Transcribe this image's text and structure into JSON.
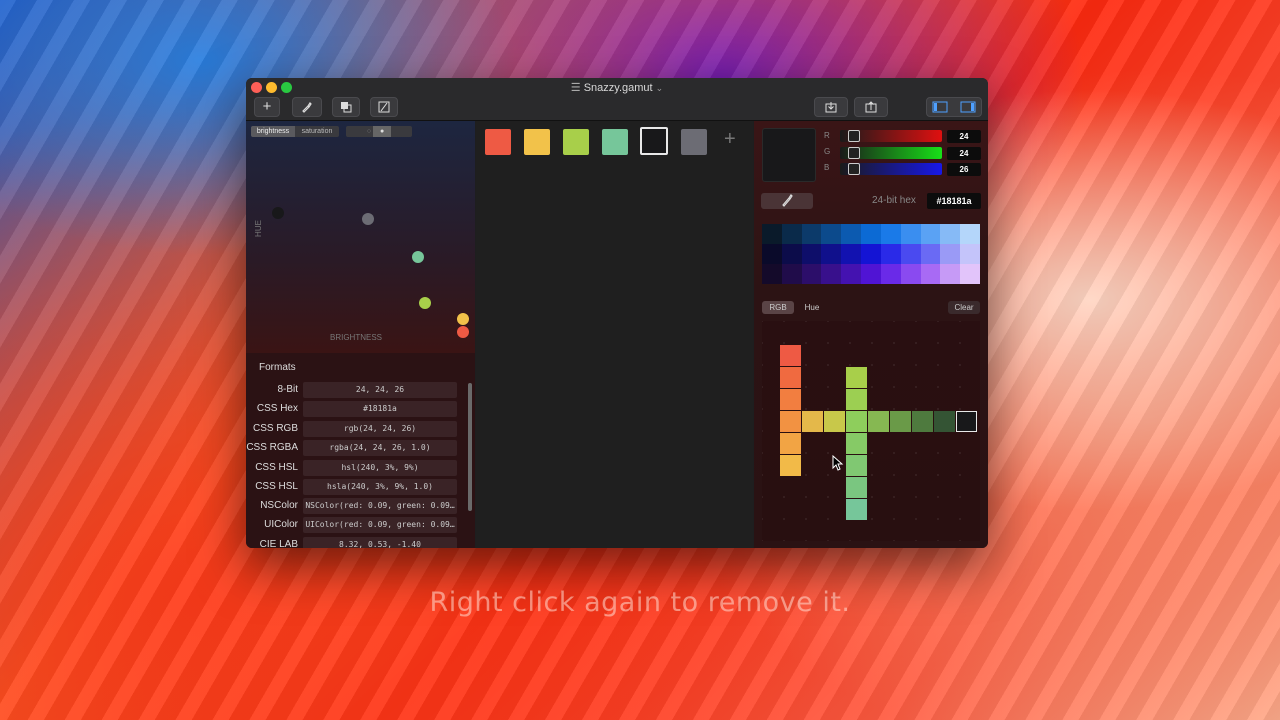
{
  "window": {
    "title": "Snazzy.gamut"
  },
  "toolbar": {
    "add_icon": "plus-icon",
    "eyedropper_icon": "eyedropper-add-icon",
    "duplicate_icon": "duplicate-icon",
    "edit_icon": "edit-icon",
    "import_icon": "import-icon",
    "export_icon": "export-icon",
    "layout_icon": "split-view-icon"
  },
  "chart_panel": {
    "seg_brightness": "brightness",
    "seg_saturation": "saturation",
    "y_axis": "HUE",
    "x_axis": "BRIGHTNESS",
    "dots": [
      {
        "color": "#18181a"
      },
      {
        "color": "#6c6c74"
      },
      {
        "color": "#76c69a"
      },
      {
        "color": "#a8cf4a"
      },
      {
        "color": "#f2c24a"
      },
      {
        "color": "#ee5a44"
      }
    ]
  },
  "formats": {
    "heading": "Formats",
    "rows": [
      {
        "label": "8-Bit",
        "value": "24, 24, 26"
      },
      {
        "label": "CSS Hex",
        "value": "#18181a"
      },
      {
        "label": "CSS RGB",
        "value": "rgb(24, 24, 26)"
      },
      {
        "label": "CSS RGBA",
        "value": "rgba(24, 24, 26, 1.0)"
      },
      {
        "label": "CSS HSL",
        "value": "hsl(240, 3%, 9%)"
      },
      {
        "label": "CSS HSL",
        "value": "hsla(240, 3%, 9%, 1.0)"
      },
      {
        "label": "NSColor",
        "value": "NSColor(red: 0.09, green: 0.09…"
      },
      {
        "label": "UIColor",
        "value": "UIColor(red: 0.09, green: 0.09…"
      },
      {
        "label": "CIE LAB",
        "value": "8.32, 0.53, -1.40"
      }
    ]
  },
  "swatches": [
    "#ee5a44",
    "#f2c24a",
    "#a8cf4a",
    "#76c69a",
    "#18181a",
    "#6c6c74"
  ],
  "add_swatch": "+",
  "color_editor": {
    "labels": [
      "R",
      "G",
      "B"
    ],
    "red": "24",
    "green": "24",
    "blue": "26",
    "hex_label": "24-bit hex",
    "hex_value": "#18181a"
  },
  "gamut_tabs": {
    "rgb": "RGB",
    "hue": "Hue",
    "clear": "Clear"
  },
  "caption": "Right click again to remove it."
}
